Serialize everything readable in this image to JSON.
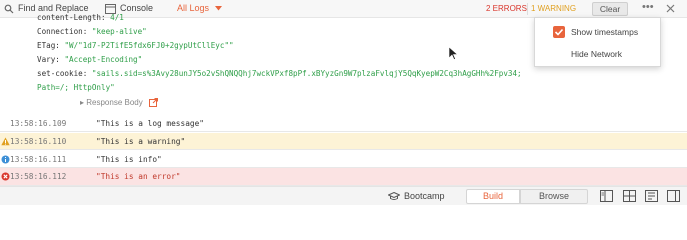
{
  "toolbar": {
    "find_replace": "Find and Replace",
    "console": "Console",
    "all_logs": "All Logs",
    "errors": "2 ERRORS",
    "warning": "1 WARNING",
    "clear": "Clear"
  },
  "headers": [
    {
      "key": "content-Length:",
      "value": "4/1"
    },
    {
      "key": "Connection:",
      "value": "\"keep-alive\""
    },
    {
      "key": "ETag:",
      "value": "\"W/\"1d7-P2TifE5fdx6FJ0+2gypUtCllEyc\"\""
    },
    {
      "key": "Vary:",
      "value": "\"Accept-Encoding\""
    },
    {
      "key": "set-cookie:",
      "value": "\"sails.sid=s%3Avy28unJY5o2vShQNQQhj7wckVPxf8pPf.xBYyzGn9W7plzaFvlqjY5QqKyepW2Cq3hAgGHh%2Fpv34;"
    },
    {
      "key": "",
      "value": "Path=/; HttpOnly\""
    }
  ],
  "response_body": "Response Body",
  "popup": {
    "show_timestamps": "Show timestamps",
    "hide_network": "Hide Network",
    "show_timestamps_checked": true,
    "hide_network_checked": false
  },
  "logs": [
    {
      "level": "log",
      "time": "13:58:16.109",
      "message": "\"This is a log message\""
    },
    {
      "level": "warn",
      "time": "13:58:16.110",
      "message": "\"This is a warning\""
    },
    {
      "level": "info",
      "time": "13:58:16.111",
      "message": "\"This is info\""
    },
    {
      "level": "error",
      "time": "13:58:16.112",
      "message": "\"This is an error\""
    }
  ],
  "bottombar": {
    "bootcamp": "Bootcamp",
    "build": "Build",
    "browse": "Browse"
  },
  "colors": {
    "accent": "#e8643c",
    "error": "#d9362c",
    "warning": "#e0a020",
    "info": "#3d8fd6",
    "string": "#2e9e48"
  }
}
